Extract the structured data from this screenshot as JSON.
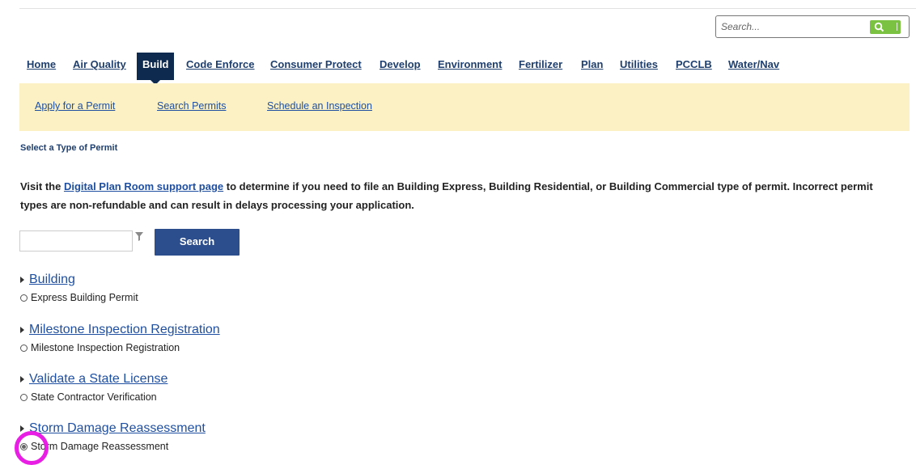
{
  "header": {
    "search_placeholder": "Search...",
    "search_button_icon": "search-icon",
    "accent_color": "#7cc242"
  },
  "nav": {
    "items": [
      {
        "label": "Home"
      },
      {
        "label": "Air Quality"
      },
      {
        "label": "Build",
        "active": true
      },
      {
        "label": "Code Enforce"
      },
      {
        "label": "Consumer Protect"
      },
      {
        "label": "Develop"
      },
      {
        "label": "Environment"
      },
      {
        "label": "Fertilizer"
      },
      {
        "label": "Plan"
      },
      {
        "label": "Utilities"
      },
      {
        "label": "PCCLB"
      },
      {
        "label": "Water/Nav"
      }
    ],
    "active_color": "#0e2a4f"
  },
  "subnav": {
    "items": [
      {
        "label": "Apply for a Permit"
      },
      {
        "label": "Search Permits"
      },
      {
        "label": "Schedule an Inspection"
      }
    ],
    "background": "#fbf1c5"
  },
  "main": {
    "section_label": "Select a Type of Permit",
    "intro_prefix": "Visit the ",
    "intro_link": "Digital Plan Room support page",
    "intro_suffix": " to determine if you need to file an Building Express, Building Residential, or Building Commercial type of permit. Incorrect permit types are non-refundable and can result in delays processing your application.",
    "filter_icon": "filter-icon",
    "search_button_label": "Search",
    "groups": [
      {
        "title": "Building",
        "option": "Express Building Permit",
        "selected": false
      },
      {
        "title": "Milestone Inspection Registration",
        "option": "Milestone Inspection Registration",
        "selected": false
      },
      {
        "title": "Validate a State License",
        "option": "State Contractor Verification",
        "selected": false
      },
      {
        "title": "Storm Damage Reassessment",
        "option": "Storm Damage Reassessment",
        "selected": true
      }
    ]
  }
}
